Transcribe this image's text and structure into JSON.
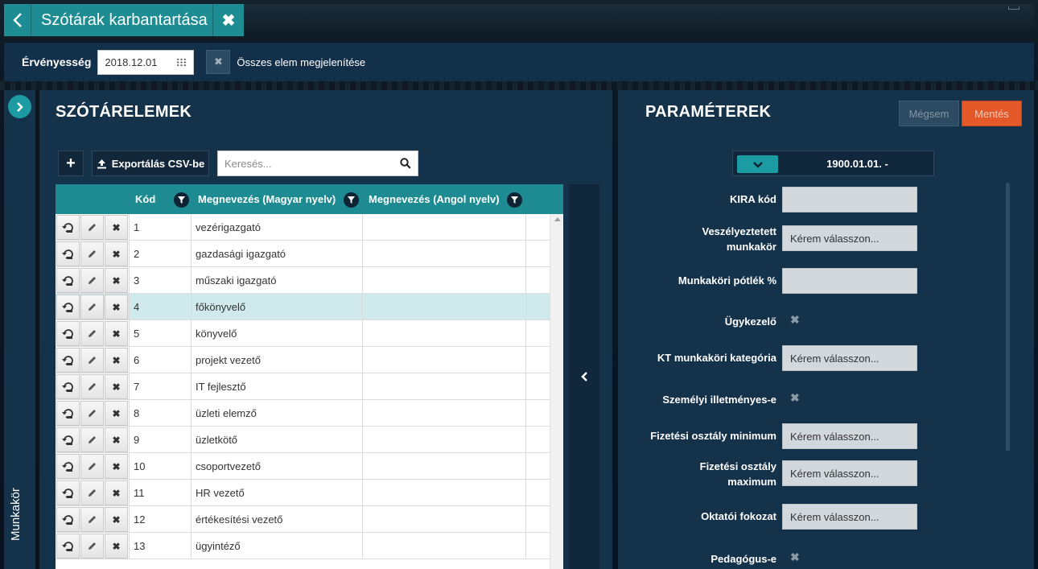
{
  "header": {
    "title": "Szótárak karbantartása"
  },
  "filter": {
    "validity_label": "Érvényesség",
    "date_value": "2018.12.01",
    "show_all_label": "Összes elem megjelenítése"
  },
  "side_tab": {
    "label": "Munkakör"
  },
  "left_panel": {
    "title": "SZÓTÁRELEMEK",
    "add_label": "+",
    "export_label": "Exportálás CSV-be",
    "search_placeholder": "Keresés...",
    "columns": [
      "Kód",
      "Megnevezés (Magyar nyelv)",
      "Megnevezés (Angol nyelv)"
    ],
    "rows": [
      {
        "kod": "1",
        "hu": "vezérigazgató",
        "en": ""
      },
      {
        "kod": "2",
        "hu": "gazdasági igazgató",
        "en": ""
      },
      {
        "kod": "3",
        "hu": "műszaki igazgató",
        "en": ""
      },
      {
        "kod": "4",
        "hu": "főkönyvelő",
        "en": ""
      },
      {
        "kod": "5",
        "hu": "könyvelő",
        "en": ""
      },
      {
        "kod": "6",
        "hu": "projekt vezető",
        "en": ""
      },
      {
        "kod": "7",
        "hu": "IT fejlesztő",
        "en": ""
      },
      {
        "kod": "8",
        "hu": "üzleti elemző",
        "en": ""
      },
      {
        "kod": "9",
        "hu": "üzletkötő",
        "en": ""
      },
      {
        "kod": "10",
        "hu": "csoportvezető",
        "en": ""
      },
      {
        "kod": "11",
        "hu": "HR vezető",
        "en": ""
      },
      {
        "kod": "12",
        "hu": "értékesítési vezető",
        "en": ""
      },
      {
        "kod": "13",
        "hu": "ügyintéző",
        "en": ""
      }
    ],
    "selected_row_index": 3
  },
  "right_panel": {
    "title": "PARAMÉTEREK",
    "cancel_label": "Mégsem",
    "save_label": "Mentés",
    "version_text": "1900.01.01. -",
    "fields": [
      {
        "label": "KIRA kód",
        "type": "input",
        "value": ""
      },
      {
        "label": "Veszélyeztetett munkakör",
        "type": "select",
        "value": "Kérem válasszon..."
      },
      {
        "label": "Munkaköri pótlék %",
        "type": "input",
        "value": ""
      },
      {
        "label": "Ügykezelő",
        "type": "checkbox",
        "value": "✖"
      },
      {
        "label": "KT munkaköri kategória",
        "type": "select",
        "value": "Kérem válasszon..."
      },
      {
        "label": "Személyi illetményes-e",
        "type": "checkbox",
        "value": "✖"
      },
      {
        "label": "Fizetési osztály minimum",
        "type": "select",
        "value": "Kérem válasszon..."
      },
      {
        "label": "Fizetési osztály maximum",
        "type": "select",
        "value": "Kérem válasszon..."
      },
      {
        "label": "Oktatói fokozat",
        "type": "select",
        "value": "Kérem válasszon..."
      },
      {
        "label": "Pedagógus-e",
        "type": "checkbox",
        "value": "✖"
      }
    ]
  },
  "colors": {
    "accent": "#1d8b91",
    "panel": "#15324b",
    "save": "#e5582a",
    "selected_row": "#cfe9ec"
  },
  "icons": {
    "back": "chevron-left-icon",
    "close": "close-icon",
    "calendar": "calendar-icon",
    "upload": "upload-icon",
    "search": "search-icon",
    "filter": "filter-icon",
    "history": "history-icon",
    "edit": "pencil-icon",
    "delete": "close-icon",
    "expand": "chevron-right-icon",
    "collapse": "chevron-left-icon",
    "dropdown": "chevron-down-icon"
  }
}
